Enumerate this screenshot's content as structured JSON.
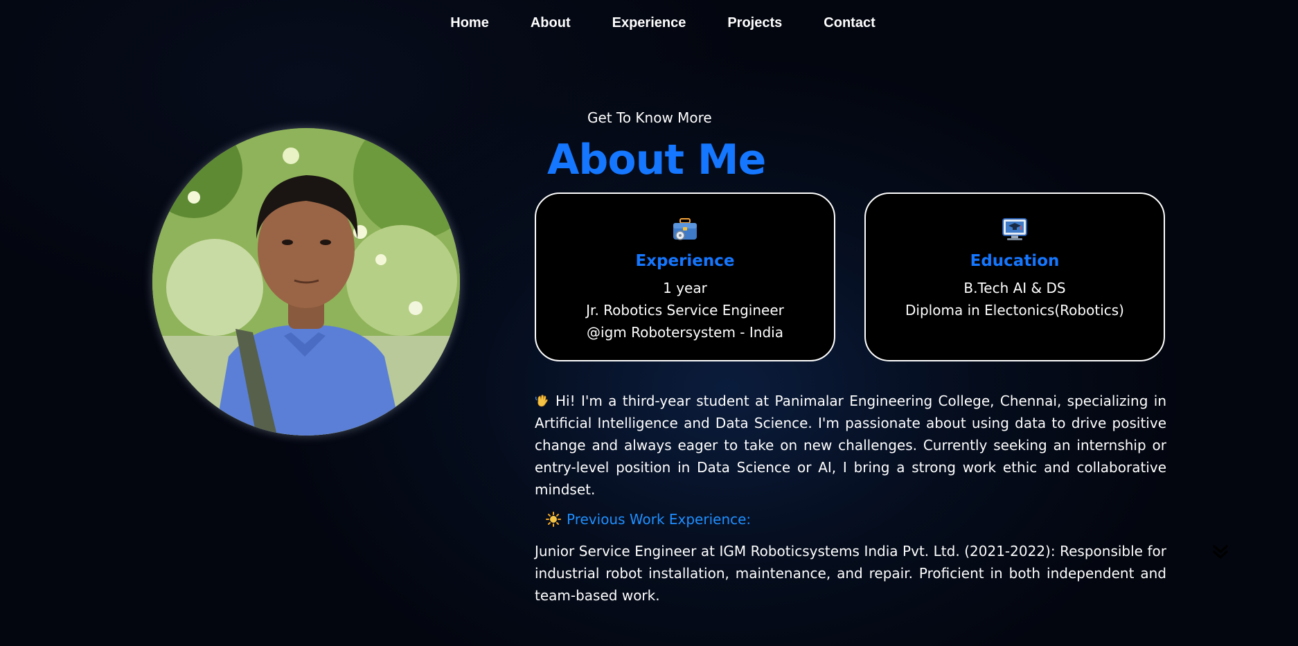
{
  "nav": {
    "items": [
      {
        "label": "Home"
      },
      {
        "label": "About"
      },
      {
        "label": "Experience"
      },
      {
        "label": "Projects"
      },
      {
        "label": "Contact"
      }
    ]
  },
  "profile": {
    "photo_alt": "profile-photo"
  },
  "about": {
    "kicker": "Get To Know More",
    "title": "About Me"
  },
  "cards": {
    "experience": {
      "icon": "briefcase-icon",
      "title": "Experience",
      "lines": [
        "1 year",
        "Jr. Robotics Service Engineer",
        "@igm Robotersystem - India"
      ]
    },
    "education": {
      "icon": "graduation-monitor-icon",
      "title": "Education",
      "lines": [
        "B.Tech AI & DS",
        "Diploma in Electonics(Robotics)"
      ]
    }
  },
  "intro": {
    "emoji": "waving-hand-icon",
    "text": "Hi! I'm a third-year student at Panimalar Engineering College, Chennai, specializing in Artificial Intelligence and Data Science. I'm passionate about using data to drive positive change and always eager to take on new challenges. Currently seeking an internship or entry-level position in Data Science or AI, I bring a strong work ethic and collaborative mindset."
  },
  "work": {
    "emoji": "sun-icon",
    "heading": "Previous Work Experience:",
    "text": "Junior Service Engineer at IGM Roboticsystems India Pvt. Ltd. (2021-2022): Responsible for industrial robot installation, maintenance, and repair. Proficient in both independent and team-based work."
  },
  "colors": {
    "accent": "#1577ff",
    "background": "#03060f",
    "card_bg": "#000000",
    "card_border": "#ffffff"
  }
}
